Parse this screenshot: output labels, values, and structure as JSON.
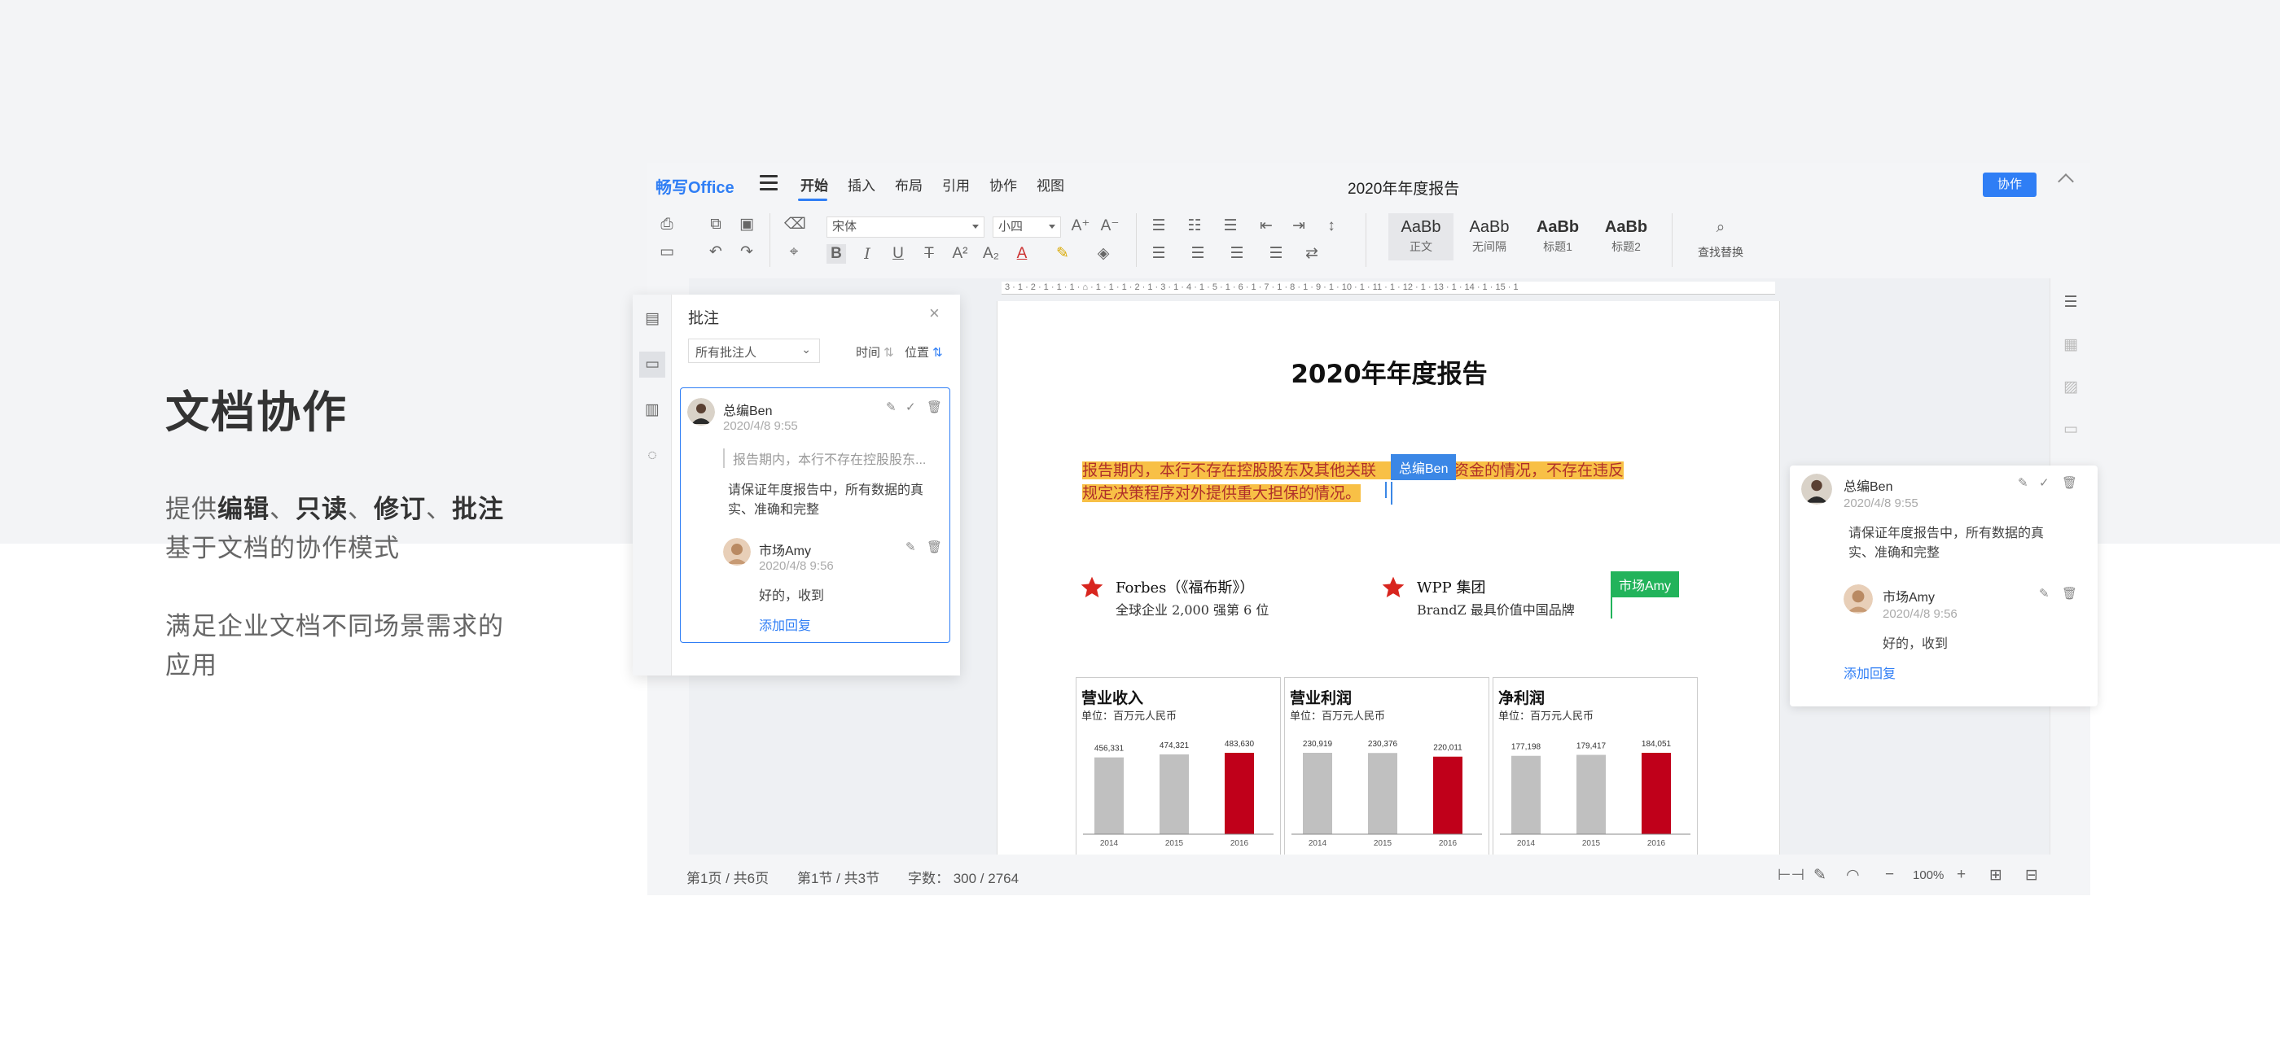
{
  "hero": {
    "title": "文档协作",
    "line1_prefix": "提供",
    "line1_b1": "编辑",
    "sep1": "、",
    "line1_b2": "只读",
    "sep2": "、",
    "line1_b3": "修订",
    "sep3": "、",
    "line1_b4": "批注",
    "line2": "基于文档的协作模式",
    "line3": "满足企业文档不同场景需求的",
    "line4": "应用"
  },
  "app": {
    "logo": "畅写Office",
    "tabs": [
      "开始",
      "插入",
      "布局",
      "引用",
      "协作",
      "视图"
    ],
    "doc_title": "2020年年度报告",
    "collab_button": "协作",
    "toolbar": {
      "font": "宋体",
      "size": "小四",
      "styles": [
        {
          "sample": "AaBb",
          "label": "正文"
        },
        {
          "sample": "AaBb",
          "label": "无间隔"
        },
        {
          "sample": "AaBb",
          "label": "标题1"
        },
        {
          "sample": "AaBb",
          "label": "标题2"
        }
      ],
      "find_replace": "查找替换"
    },
    "ruler": "3 · 1 · 2 · 1 · 1 · 1 · ⌂ · 1 · 1 · 1 · 2 · 1 · 3 · 1 · 4 · 1 · 5 · 1 · 6 · 1 · 7 · 1 · 8 · 1 · 9 · 1 · 10 · 1 · 11 · 1 · 12 · 1 · 13 · 1 · 14 · 1 · 15 · 1"
  },
  "document": {
    "title": "2020年年度报告",
    "para_line1_a": "报告期内，本行不存在控股股东及其他关联",
    "para_line1_b": "性占用资金的情况，不存在违反",
    "para_line2": "规定决策程序对外提供重大担保的情况。",
    "badge_ben": "总编Ben",
    "badge_amy": "市场Amy",
    "brands": [
      {
        "name": "Forbes（《福布斯》）",
        "sub": "全球企业 2,000 强第 6 位"
      },
      {
        "name": "WPP 集团",
        "sub": "BrandZ 最具价值中国品牌"
      }
    ]
  },
  "chart_data": [
    {
      "type": "bar",
      "title": "营业收入",
      "unit": "单位：百万元人民币",
      "categories": [
        "2014",
        "2015",
        "2016"
      ],
      "values": [
        456331,
        474321,
        483630
      ],
      "labels": [
        "456,331",
        "474,321",
        "483,630"
      ],
      "colors": [
        "#c0c0c0",
        "#c0c0c0",
        "#c0001a"
      ]
    },
    {
      "type": "bar",
      "title": "营业利润",
      "unit": "单位：百万元人民币",
      "categories": [
        "2014",
        "2015",
        "2016"
      ],
      "values": [
        230919,
        230376,
        220011
      ],
      "labels": [
        "230,919",
        "230,376",
        "220,011"
      ],
      "colors": [
        "#c0c0c0",
        "#c0c0c0",
        "#c0001a"
      ]
    },
    {
      "type": "bar",
      "title": "净利润",
      "unit": "单位：百万元人民币",
      "categories": [
        "2014",
        "2015",
        "2016"
      ],
      "values": [
        177198,
        179417,
        184051
      ],
      "labels": [
        "177,198",
        "179,417",
        "184,051"
      ],
      "colors": [
        "#c0c0c0",
        "#c0c0c0",
        "#c0001a"
      ]
    }
  ],
  "comments_panel": {
    "title": "批注",
    "filter": "所有批注人",
    "sort_time": "时间",
    "sort_pos": "位置",
    "comment": {
      "author": "总编Ben",
      "time": "2020/4/8 9:55",
      "quote": "报告期内，本行不存在控股股东...",
      "text_line1": "请保证年度报告中，所有数据的真",
      "text_line2": "实、准确和完整",
      "reply_author": "市场Amy",
      "reply_time": "2020/4/8 9:56",
      "reply_text": "好的，收到",
      "add_reply": "添加回复"
    }
  },
  "float_comment": {
    "author": "总编Ben",
    "time": "2020/4/8 9:55",
    "text_line1": "请保证年度报告中，所有数据的真",
    "text_line2": "实、准确和完整",
    "reply_author": "市场Amy",
    "reply_time": "2020/4/8 9:56",
    "reply_text": "好的，收到",
    "add_reply": "添加回复"
  },
  "status": {
    "page": "第1页 / 共6页",
    "section": "第1节 / 共3节",
    "words": "字数： 300 / 2764",
    "zoom": "100%"
  },
  "colors": {
    "accent": "#2f7ef5",
    "highlight": "#f8c046",
    "ben_badge": "#3b87e6",
    "amy_badge": "#22b35b",
    "bar_red": "#c0001a",
    "bar_gray": "#c0c0c0"
  }
}
